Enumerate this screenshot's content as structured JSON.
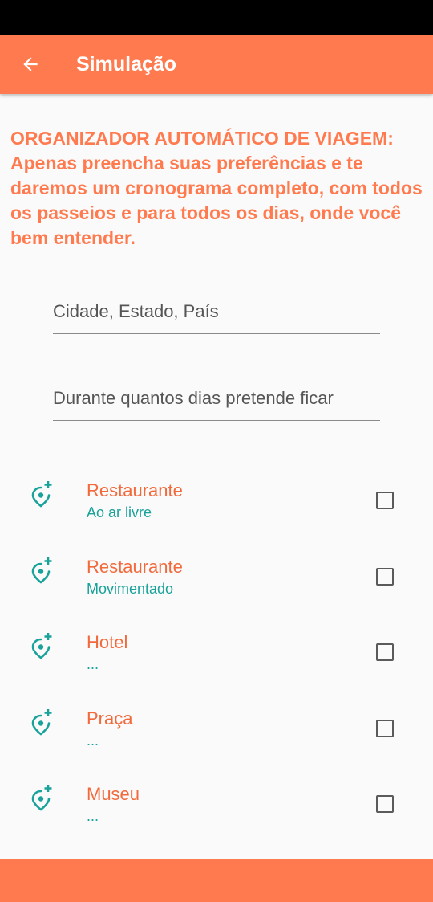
{
  "app_bar": {
    "title": "Simulação",
    "back_icon": "arrow-left-icon"
  },
  "intro": {
    "text": "ORGANIZADOR AUTOMÁTICO DE VIAGEM: Apenas preencha suas preferências e te daremos um cronograma completo, com todos os passeios e para todos os dias, onde você bem entender."
  },
  "form": {
    "city_placeholder": "Cidade, Estado, País",
    "city_value": "",
    "days_placeholder": "Durante quantos dias pretende ficar",
    "days_value": ""
  },
  "options": [
    {
      "title": "Restaurante",
      "subtitle": "Ao ar livre",
      "icon": "add-location-icon",
      "checked": false
    },
    {
      "title": "Restaurante",
      "subtitle": "Movimentado",
      "icon": "add-location-icon",
      "checked": false
    },
    {
      "title": "Hotel",
      "subtitle": "...",
      "icon": "add-location-icon",
      "checked": false
    },
    {
      "title": "Praça",
      "subtitle": "...",
      "icon": "add-location-icon",
      "checked": false
    },
    {
      "title": "Museu",
      "subtitle": "...",
      "icon": "add-location-icon",
      "checked": false
    }
  ],
  "colors": {
    "accent": "#ff7b4f",
    "title_text": "#f26a3c",
    "secondary": "#18a29a",
    "background": "#fafafa"
  }
}
